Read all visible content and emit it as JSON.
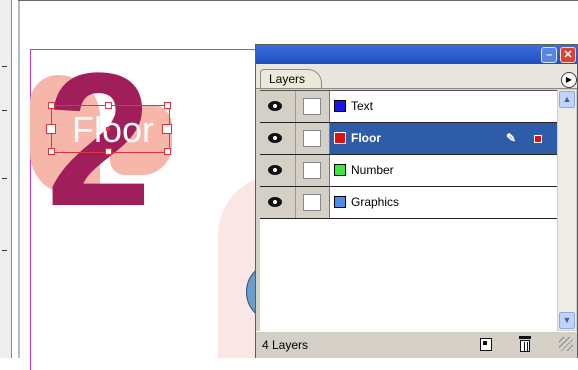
{
  "document": {
    "floor_text": "Floor",
    "digit_text": "2"
  },
  "layers_panel": {
    "tab_label": "Layers",
    "minimize_glyph": "–",
    "close_glyph": "✕",
    "menu_glyph": "▶",
    "layers": [
      {
        "name": "Text",
        "color": "#1616e6",
        "visible": true,
        "selected": false
      },
      {
        "name": "Floor",
        "color": "#e01010",
        "visible": true,
        "selected": true
      },
      {
        "name": "Number",
        "color": "#3ee63e",
        "visible": true,
        "selected": false
      },
      {
        "name": "Graphics",
        "color": "#4c8ce8",
        "visible": true,
        "selected": false
      }
    ],
    "layer_count": "4 Layers",
    "pen_glyph": "✎",
    "scroll_up_glyph": "▲",
    "scroll_down_glyph": "▼"
  },
  "colors": {
    "page_border": "#c63cc6",
    "selection": "#e0333b",
    "digit": "#a01e5a",
    "title_bar": "#1f4fbe",
    "selected_row": "#2f5ca8"
  }
}
